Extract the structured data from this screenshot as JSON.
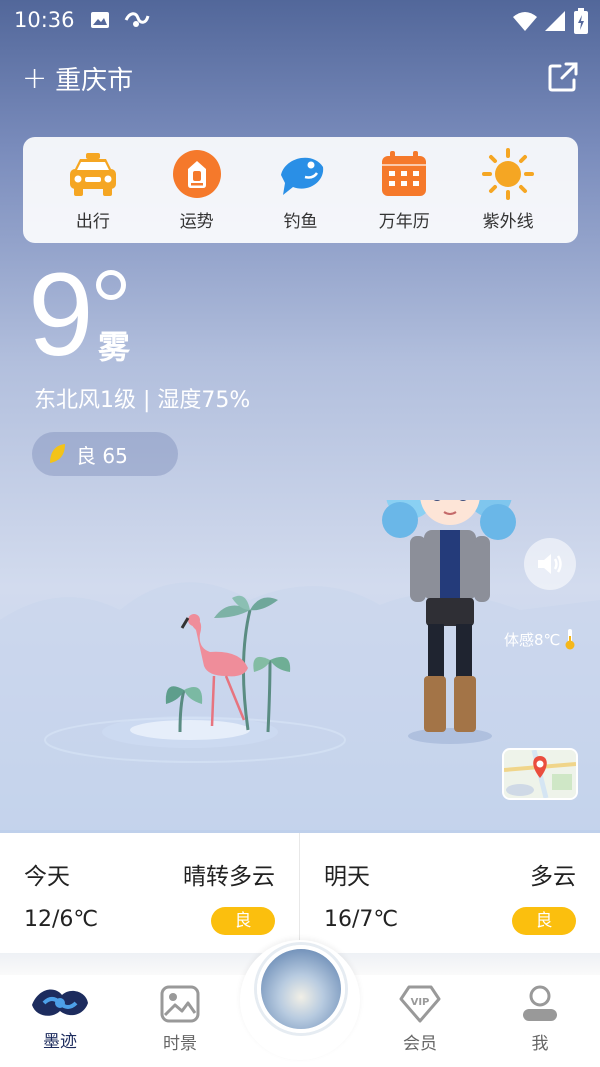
{
  "status_bar": {
    "time": "10:36"
  },
  "header": {
    "add_label": "+",
    "city": "重庆市"
  },
  "quick_actions": [
    {
      "label": "出行",
      "icon": "taxi-icon",
      "color": "#f5a623"
    },
    {
      "label": "运势",
      "icon": "fortune-icon",
      "color": "#f5792b"
    },
    {
      "label": "钓鱼",
      "icon": "fish-icon",
      "color": "#2a8fe6"
    },
    {
      "label": "万年历",
      "icon": "calendar-icon",
      "color": "#f5792b"
    },
    {
      "label": "紫外线",
      "icon": "sun-icon",
      "color": "#f5a623"
    }
  ],
  "current": {
    "temperature": "9",
    "condition": "雾",
    "wind_humidity": "东北风1级 | 湿度75%",
    "aqi_label": "良 65",
    "feels_like": "体感8℃"
  },
  "forecast": [
    {
      "day": "今天",
      "condition": "晴转多云",
      "range": "12/6℃",
      "aqi": "良"
    },
    {
      "day": "明天",
      "condition": "多云",
      "range": "16/7℃",
      "aqi": "良"
    }
  ],
  "nav": [
    {
      "label": "墨迹",
      "icon": "moji-icon",
      "active": true
    },
    {
      "label": "时景",
      "icon": "gallery-icon",
      "active": false
    },
    {
      "label": "会员",
      "icon": "vip-icon",
      "active": false
    },
    {
      "label": "我",
      "icon": "profile-icon",
      "active": false
    }
  ],
  "colors": {
    "accent": "#fbbf0e",
    "nav_active": "#1d2c5e"
  }
}
